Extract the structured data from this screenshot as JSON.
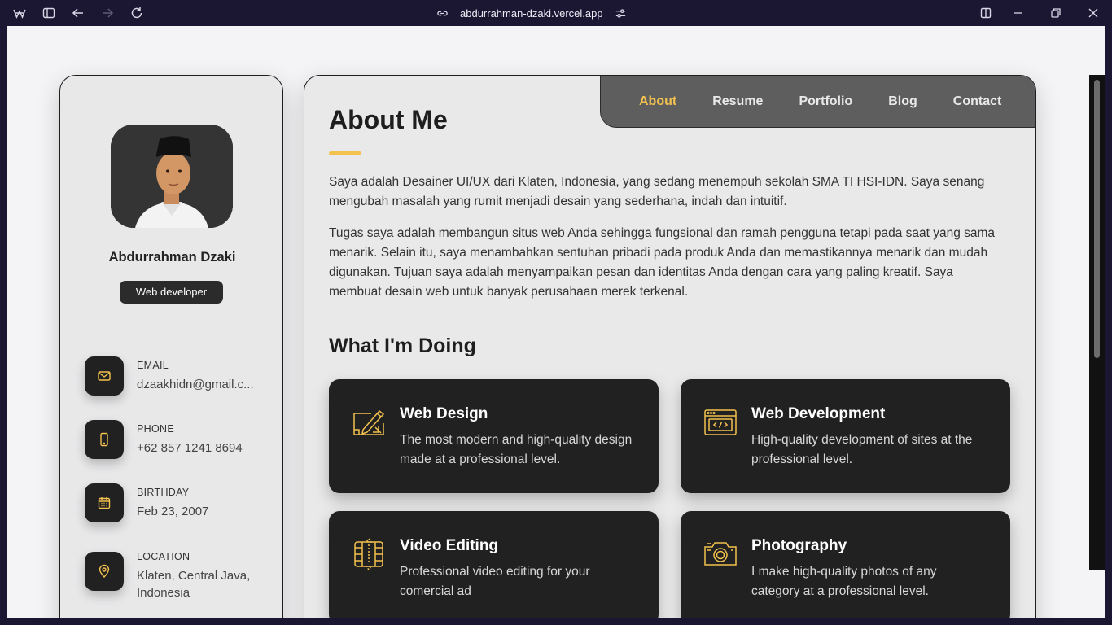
{
  "browser": {
    "url": "abdurrahman-dzaki.vercel.app"
  },
  "profile": {
    "name": "Abdurrahman Dzaki",
    "role": "Web developer"
  },
  "contacts": [
    {
      "label": "EMAIL",
      "value": "dzaakhidn@gmail.c...",
      "icon": "mail-icon"
    },
    {
      "label": "PHONE",
      "value": "+62 857 1241 8694",
      "icon": "phone-icon"
    },
    {
      "label": "BIRTHDAY",
      "value": "Feb 23, 2007",
      "icon": "calendar-icon"
    },
    {
      "label": "LOCATION",
      "value": "Klaten, Central Java, Indonesia",
      "icon": "location-pin-icon"
    }
  ],
  "nav": {
    "items": [
      {
        "label": "About",
        "active": true
      },
      {
        "label": "Resume",
        "active": false
      },
      {
        "label": "Portfolio",
        "active": false
      },
      {
        "label": "Blog",
        "active": false
      },
      {
        "label": "Contact",
        "active": false
      }
    ]
  },
  "about": {
    "title": "About Me",
    "para1": "Saya adalah Desainer UI/UX dari Klaten, Indonesia, yang sedang menempuh sekolah SMA TI HSI-IDN. Saya senang mengubah masalah yang rumit menjadi desain yang sederhana, indah dan intuitif.",
    "para2": "Tugas saya adalah membangun situs web Anda sehingga fungsional dan ramah pengguna tetapi pada saat yang sama menarik. Selain itu, saya menambahkan sentuhan pribadi pada produk Anda dan memastikannya menarik dan mudah digunakan. Tujuan saya adalah menyampaikan pesan dan identitas Anda dengan cara yang paling kreatif. Saya membuat desain web untuk banyak perusahaan merek terkenal."
  },
  "services": {
    "title": "What I'm Doing",
    "items": [
      {
        "title": "Web Design",
        "desc": "The most modern and high-quality design made at a professional level.",
        "icon": "design-pencil-icon"
      },
      {
        "title": "Web Development",
        "desc": "High-quality development of sites at the professional level.",
        "icon": "code-window-icon"
      },
      {
        "title": "Video Editing",
        "desc": "Professional video editing for your comercial ad",
        "icon": "film-strip-icon"
      },
      {
        "title": "Photography",
        "desc": "I make high-quality photos of any category at a professional level.",
        "icon": "camera-icon"
      }
    ]
  },
  "colors": {
    "accent": "#f2c14e",
    "card_dark": "#212121",
    "nav_bg": "#5e5e5e",
    "page_bg": "#e9e9ea",
    "chrome_bg": "#1b1733"
  }
}
